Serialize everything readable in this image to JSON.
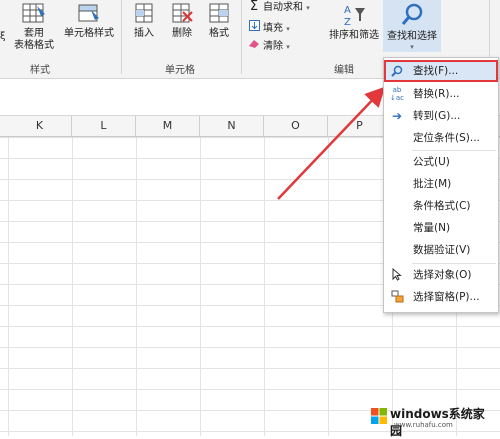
{
  "ribbon": {
    "buttons": {
      "table_format": "套用\n表格格式",
      "cell_style": "单元格样式",
      "insert": "插入",
      "delete": "删除",
      "format": "格式",
      "sort_filter": "排序和筛选",
      "find_select": "查找和选择"
    },
    "small": {
      "autosum": "自动求和",
      "fill": "填充",
      "clear": "清除"
    },
    "groups": {
      "styles": "样式",
      "cells": "单元格",
      "editing": "编辑"
    }
  },
  "columns": [
    "K",
    "L",
    "M",
    "N",
    "O",
    "P"
  ],
  "menu": {
    "items": [
      {
        "label": "查找(F)...",
        "icon": "search-icon",
        "active": true
      },
      {
        "label": "替换(R)...",
        "icon": "replace-icon"
      },
      {
        "label": "转到(G)...",
        "icon": "goto-arrow-icon"
      },
      {
        "label": "定位条件(S)..."
      },
      {
        "label": "公式(U)"
      },
      {
        "label": "批注(M)"
      },
      {
        "label": "条件格式(C)"
      },
      {
        "label": "常量(N)"
      },
      {
        "label": "数据验证(V)"
      },
      {
        "label": "选择对象(O)",
        "icon": "pointer-icon"
      },
      {
        "label": "选择窗格(P)...",
        "icon": "selection-pane-icon"
      }
    ]
  },
  "watermark": {
    "brand": "windows系统家园",
    "url": "www.ruhafu.com"
  },
  "colors": {
    "highlight": "#d9e6f5",
    "annotation_red": "#e2383b"
  }
}
